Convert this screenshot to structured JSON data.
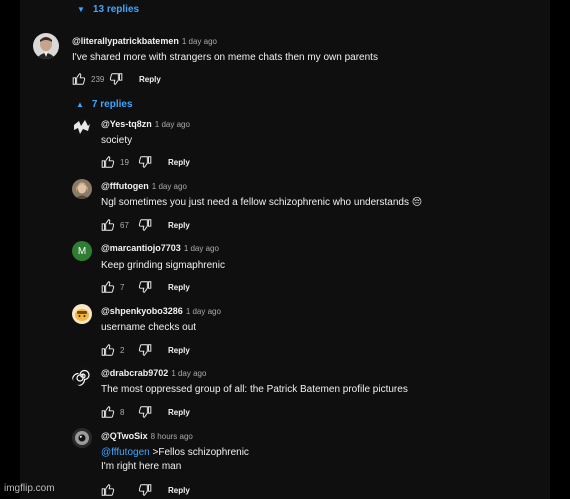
{
  "thread": {
    "replies_toggle_label": "13 replies",
    "nested_toggle_label": "7 replies",
    "reply_label": "Reply"
  },
  "top_comment": {
    "handle": "@literallypatrickbatemen",
    "time": "1 day ago",
    "text": "I've shared more with strangers on meme chats then my own parents",
    "likes": "239"
  },
  "replies": [
    {
      "handle": "@Yes-tq8zn",
      "time": "1 day ago",
      "text": "society",
      "likes": "19",
      "avatar_icon": "jagged-logo-icon"
    },
    {
      "handle": "@fffutogen",
      "time": "1 day ago",
      "text": "Ngl sometimes you just need a fellow schizophrenic who understands 😔",
      "likes": "67",
      "avatar_icon": "profile-photo-icon"
    },
    {
      "handle": "@marcantiojo7703",
      "time": "1 day ago",
      "text": "Keep grinding sigmaphrenic",
      "likes": "7",
      "avatar_icon": "letter-avatar-icon",
      "avatar_letter": "M",
      "avatar_color": "#2e7d32"
    },
    {
      "handle": "@shpenkyobo3286",
      "time": "1 day ago",
      "text": "username checks out",
      "likes": "2",
      "avatar_icon": "cartoon-avatar-icon"
    },
    {
      "handle": "@drabcrab9702",
      "time": "1 day ago",
      "text": "The most oppressed group of all: the Patrick Batemen profile pictures",
      "likes": "8",
      "avatar_icon": "spiral-icon"
    },
    {
      "handle": "@QTwoSix",
      "time": "8 hours ago",
      "mention": "@fffutogen",
      "text": ">Fellos schizophrenic",
      "text2": "I'm right here man",
      "likes": "",
      "avatar_icon": "eye-avatar-icon"
    }
  ],
  "watermark": "imgflip.com",
  "colors": {
    "background": "#0f0f0f",
    "accent": "#3ea6ff",
    "muted": "#aaaaaa"
  }
}
